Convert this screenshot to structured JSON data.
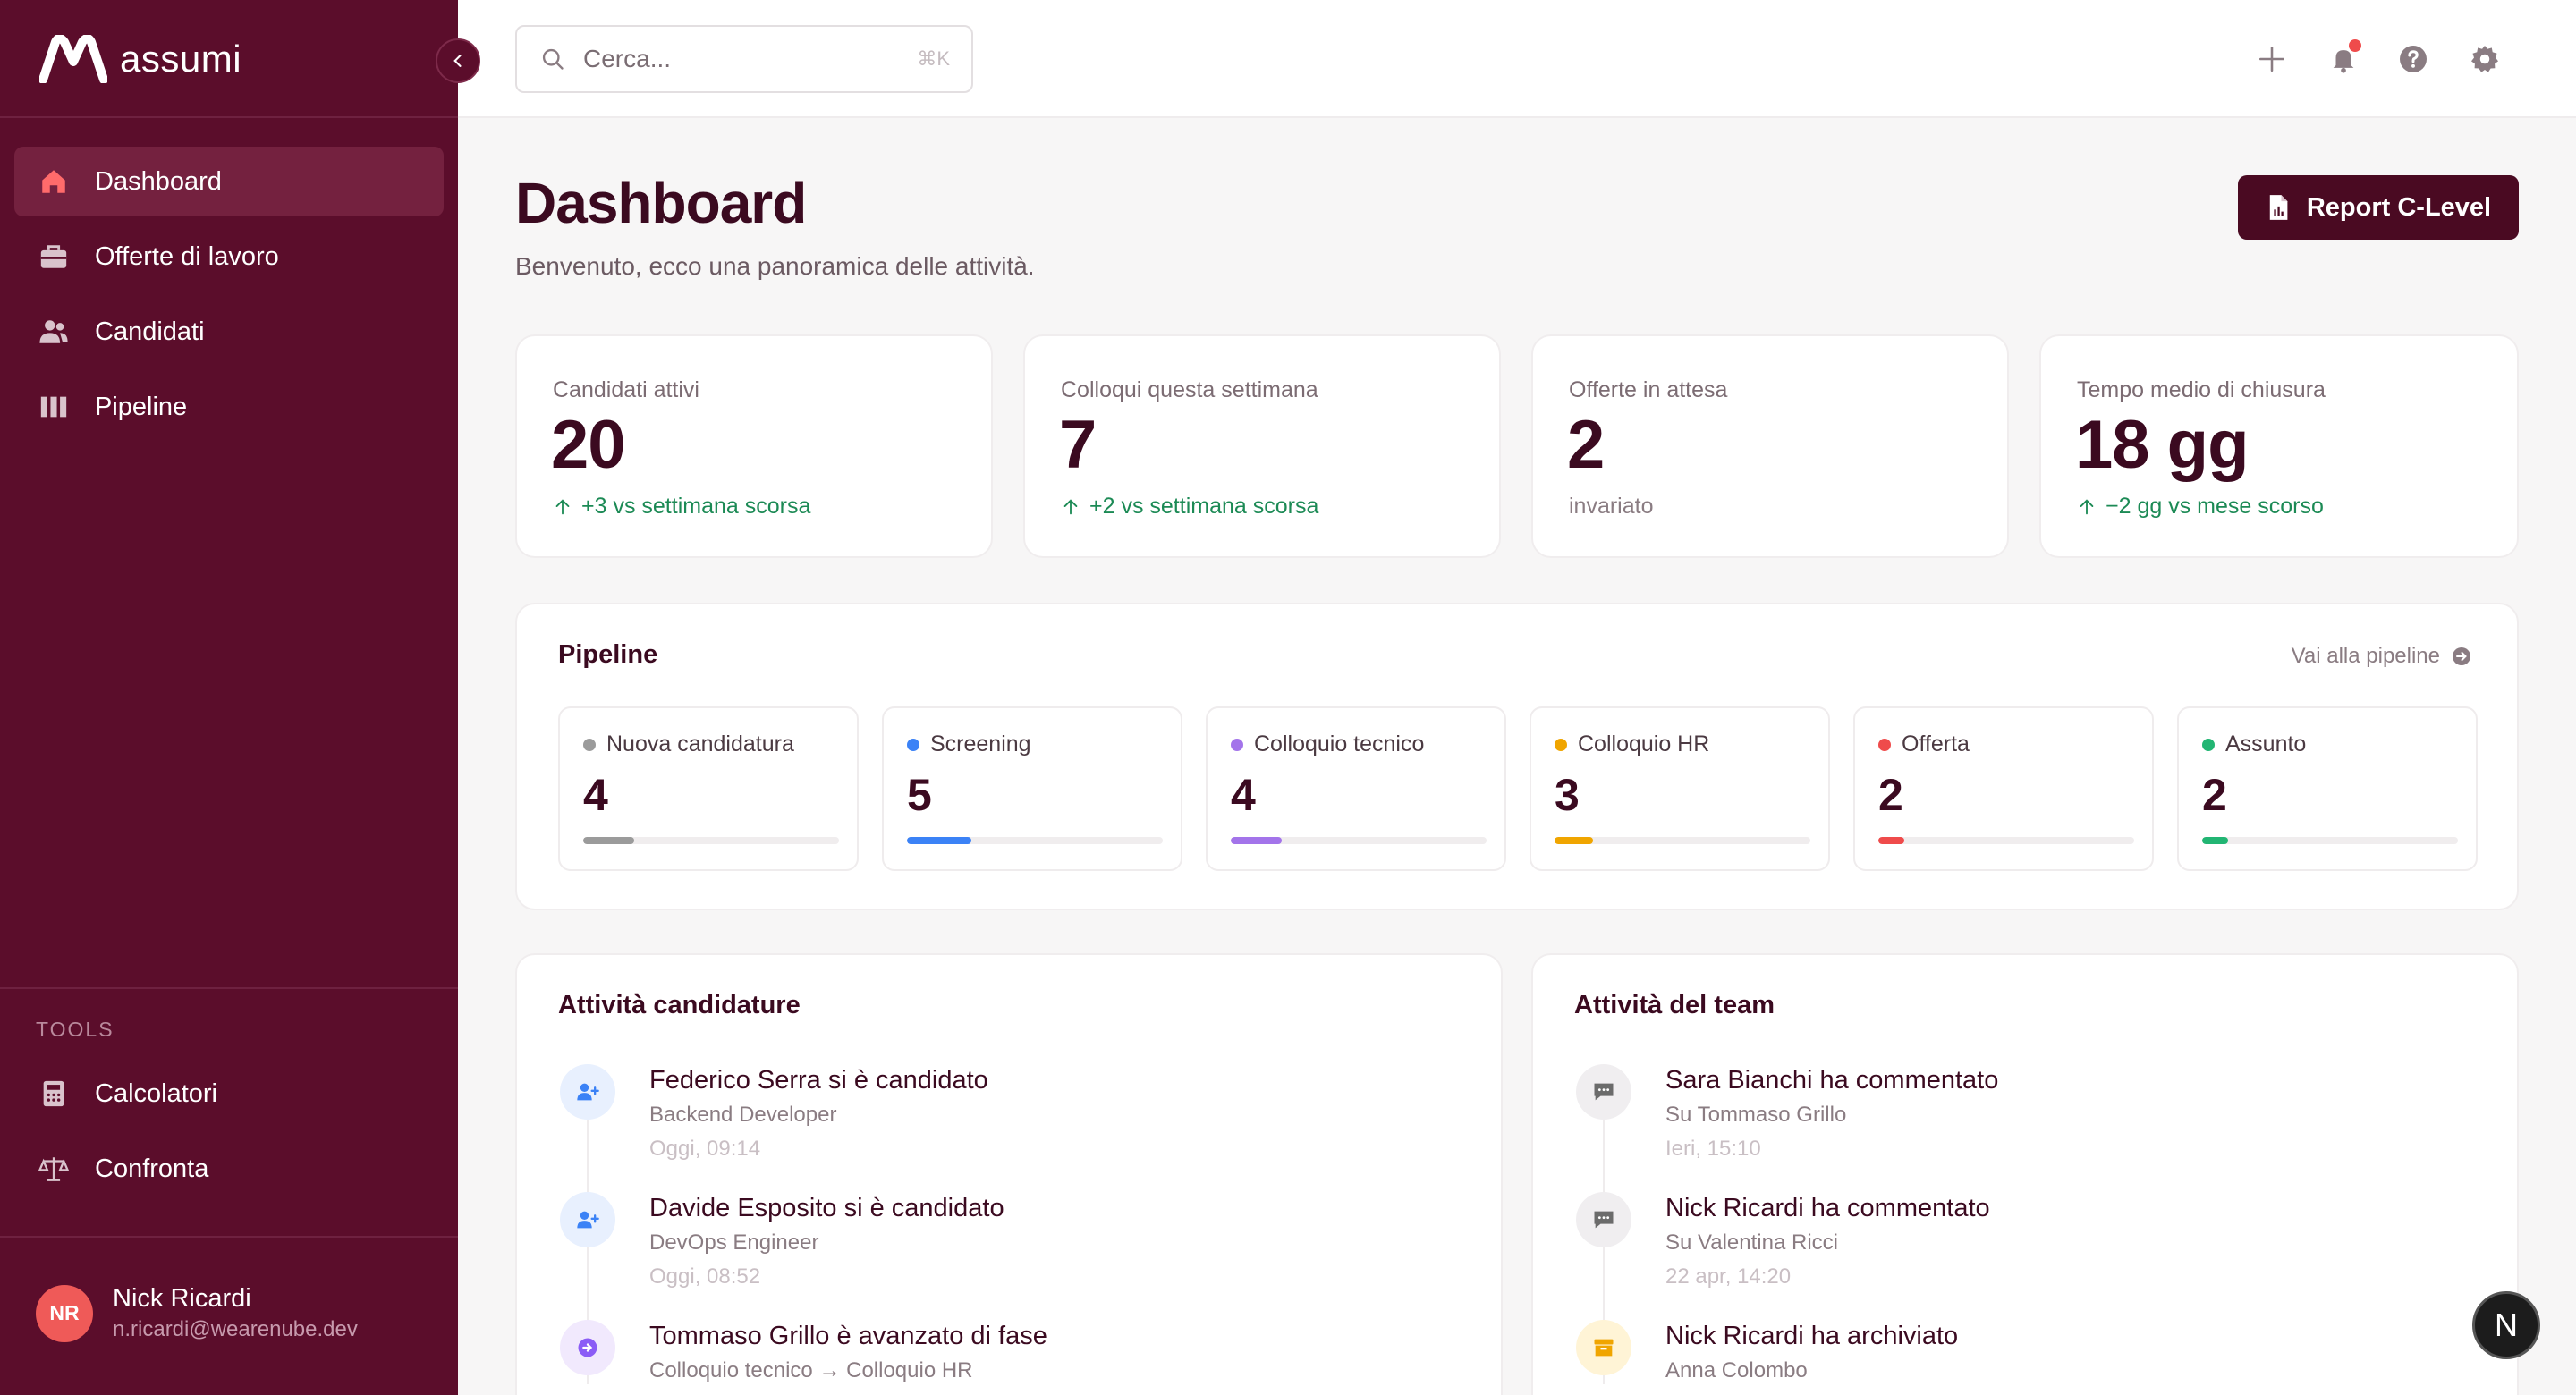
{
  "app": {
    "name": "assumi"
  },
  "search": {
    "placeholder": "Cerca...",
    "shortcut": "⌘K"
  },
  "sidebar": {
    "nav": [
      {
        "label": "Dashboard",
        "icon": "home-icon",
        "active": true
      },
      {
        "label": "Offerte di lavoro",
        "icon": "briefcase-icon",
        "active": false
      },
      {
        "label": "Candidati",
        "icon": "users-icon",
        "active": false
      },
      {
        "label": "Pipeline",
        "icon": "kanban-icon",
        "active": false
      }
    ],
    "tools_label": "TOOLS",
    "tools": [
      {
        "label": "Calcolatori",
        "icon": "calculator-icon"
      },
      {
        "label": "Confronta",
        "icon": "scale-icon"
      }
    ],
    "user": {
      "initials": "NR",
      "name": "Nick Ricardi",
      "email": "n.ricardi@wearenube.dev"
    }
  },
  "header": {
    "title": "Dashboard",
    "subtitle": "Benvenuto, ecco una panoramica delle attività.",
    "report_button": "Report C-Level"
  },
  "stats": [
    {
      "label": "Candidati attivi",
      "value": "20",
      "change": "+3 vs settimana scorsa",
      "trend": "up"
    },
    {
      "label": "Colloqui questa settimana",
      "value": "7",
      "change": "+2 vs settimana scorsa",
      "trend": "up"
    },
    {
      "label": "Offerte in attesa",
      "value": "2",
      "change": "invariato",
      "trend": "neutral"
    },
    {
      "label": "Tempo medio di chiusura",
      "value": "18 gg",
      "change": "−2 gg vs mese scorso",
      "trend": "up"
    }
  ],
  "pipeline": {
    "title": "Pipeline",
    "link": "Vai alla pipeline",
    "stages": [
      {
        "label": "Nuova candidatura",
        "count": "4",
        "color": "#9b9b9b",
        "fraction": 0.2
      },
      {
        "label": "Screening",
        "count": "5",
        "color": "#3b82f6",
        "fraction": 0.25
      },
      {
        "label": "Colloquio tecnico",
        "count": "4",
        "color": "#a374ea",
        "fraction": 0.2
      },
      {
        "label": "Colloquio HR",
        "count": "3",
        "color": "#f0a500",
        "fraction": 0.15
      },
      {
        "label": "Offerta",
        "count": "2",
        "color": "#ef4b4b",
        "fraction": 0.1
      },
      {
        "label": "Assunto",
        "count": "2",
        "color": "#22b573",
        "fraction": 0.1
      }
    ]
  },
  "activity_candidates": {
    "title": "Attività candidature",
    "items": [
      {
        "title": "Federico Serra si è candidato",
        "sub": "Backend Developer",
        "time": "Oggi, 09:14",
        "icon": "user-plus-icon"
      },
      {
        "title": "Davide Esposito si è candidato",
        "sub": "DevOps Engineer",
        "time": "Oggi, 08:52",
        "icon": "user-plus-icon"
      },
      {
        "title": "Tommaso Grillo è avanzato di fase",
        "sub": "Colloquio tecnico → Colloquio HR",
        "time": "",
        "icon": "arrow-right-icon"
      }
    ]
  },
  "activity_team": {
    "title": "Attività del team",
    "items": [
      {
        "title": "Sara Bianchi ha commentato",
        "sub": "Su Tommaso Grillo",
        "time": "Ieri, 15:10",
        "icon": "comment-icon"
      },
      {
        "title": "Nick Ricardi ha commentato",
        "sub": "Su Valentina Ricci",
        "time": "22 apr, 14:20",
        "icon": "comment-icon"
      },
      {
        "title": "Nick Ricardi ha archiviato",
        "sub": "Anna Colombo",
        "time": "",
        "icon": "archive-icon"
      }
    ]
  },
  "fab": {
    "label": "N"
  }
}
